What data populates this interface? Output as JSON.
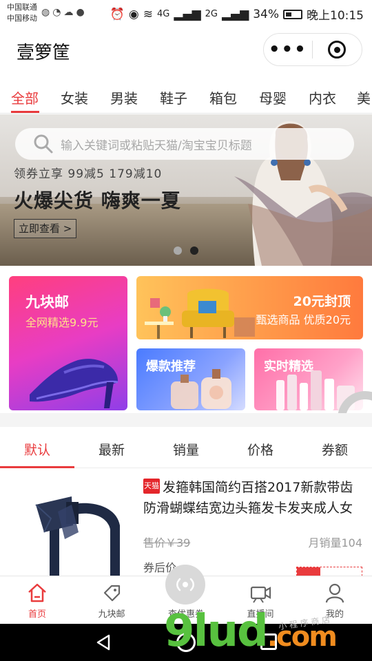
{
  "status_bar": {
    "carrier1": "中国联通",
    "carrier2": "中国移动",
    "network1": "4G",
    "network2": "2G",
    "battery": "34%",
    "time": "晚上10:15"
  },
  "nav": {
    "title": "壹箩筐",
    "more_label": "•••"
  },
  "categories": [
    "全部",
    "女装",
    "男装",
    "鞋子",
    "箱包",
    "母婴",
    "内衣",
    "美"
  ],
  "banner": {
    "search_placeholder": "输入关键词或粘贴天猫/淘宝宝贝标题",
    "coupon_text": "领券立享 99减5 179减10",
    "headline": "火爆尖货 嗨爽一夏",
    "button": "立即查看 >",
    "current_slide": 2,
    "slide_count": 2
  },
  "promos": {
    "nine": {
      "title": "九块邮",
      "subtitle": "全网精选9.9元"
    },
    "twenty": {
      "title": "20元封顶",
      "subtitle": "甄选商品 优质20元"
    },
    "hot": {
      "title": "爆款推荐"
    },
    "live": {
      "title": "实时精选"
    }
  },
  "sort_tabs": [
    "默认",
    "最新",
    "销量",
    "价格",
    "券额"
  ],
  "product": {
    "platform_tag": "天猫",
    "title": "发箍韩国简约百搭2017新款带齿防滑蝴蝶结宽边头箍发卡发夹成人女",
    "original_price": "售价￥39",
    "monthly_sales": "月销量104",
    "after_coupon": "券后价"
  },
  "tabbar": [
    {
      "label": "首页",
      "icon": "home-icon",
      "active": true
    },
    {
      "label": "九块邮",
      "icon": "tag-icon",
      "active": false
    },
    {
      "label": "查优惠券",
      "icon": "live-broadcast-icon",
      "active": false
    },
    {
      "label": "直播间",
      "icon": "video-icon",
      "active": false
    },
    {
      "label": "我的",
      "icon": "user-icon",
      "active": false
    }
  ],
  "watermark": {
    "brand": "9lud",
    "suffix": ".com",
    "sub": "小 程 序 商 店"
  },
  "colors": {
    "accent": "#e93b3d",
    "nine_gradient": "#ff3f7e",
    "twenty_gradient": "#ff9a4a",
    "hot_gradient": "#4a7bff",
    "live_gradient": "#ff6fa8",
    "watermark_green": "#58c13f",
    "watermark_orange": "#f08c1f"
  }
}
